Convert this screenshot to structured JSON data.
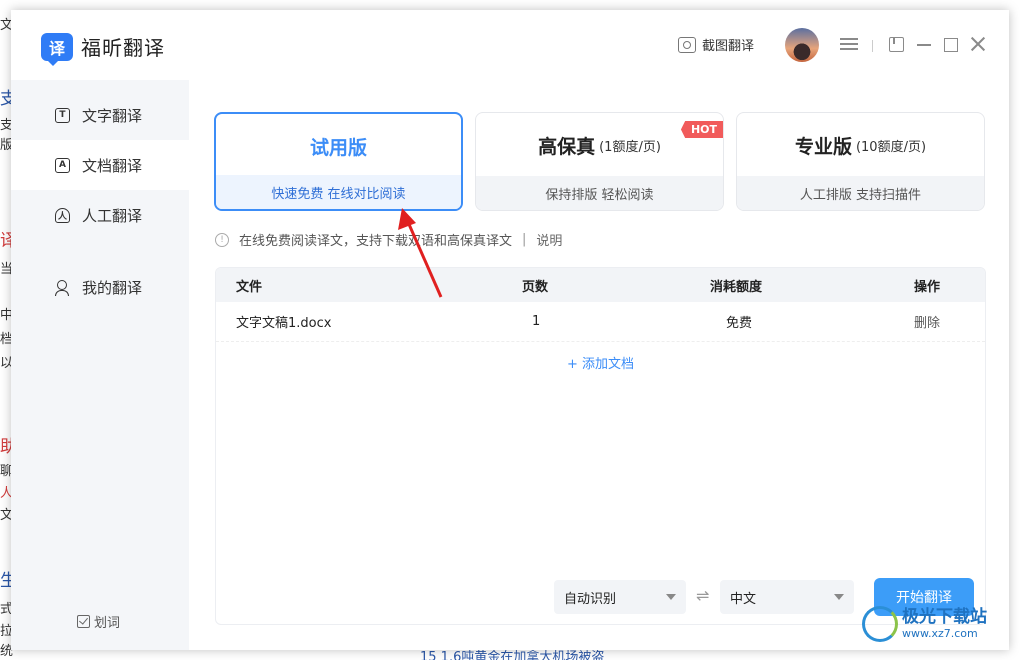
{
  "background": {
    "fragments": [
      "文",
      "支",
      "版",
      "译",
      "当",
      "中",
      "档",
      "以",
      "助",
      "聊",
      "人",
      "文",
      "生",
      "式",
      "拉",
      "统"
    ],
    "bottom_text": "15  1.6吨黄金在加拿大机场被盗"
  },
  "app": {
    "name": "福昕翻译",
    "logo_glyph": "译",
    "screenshot_translate": "截图翻译"
  },
  "sidebar": {
    "items": [
      {
        "label": "文字翻译",
        "icon": "T"
      },
      {
        "label": "文档翻译",
        "icon": "A"
      },
      {
        "label": "人工翻译",
        "icon": "人"
      },
      {
        "label": "我的翻译",
        "icon": "user-icon"
      }
    ],
    "word_pick": "划词"
  },
  "plans": [
    {
      "name": "试用版",
      "sub": "",
      "desc": "快速免费 在线对比阅读",
      "selected": true
    },
    {
      "name": "高保真",
      "sub": "(1额度/页)",
      "desc": "保持排版 轻松阅读",
      "badge": "HOT"
    },
    {
      "name": "专业版",
      "sub": "(10额度/页)",
      "desc": "人工排版 支持扫描件"
    }
  ],
  "notice": {
    "text": "在线免费阅读译文，支持下载双语和高保真译文",
    "sep": "|",
    "link": "说明"
  },
  "table": {
    "headers": {
      "file": "文件",
      "pages": "页数",
      "cost": "消耗额度",
      "action": "操作"
    },
    "rows": [
      {
        "file": "文字文稿1.docx",
        "pages": "1",
        "cost": "免费",
        "action": "删除"
      }
    ],
    "add_doc": "+ 添加文档"
  },
  "controls": {
    "source_lang": "自动识别",
    "swap": "⇌",
    "target_lang": "中文",
    "start": "开始翻译"
  },
  "watermark": {
    "name": "极光下载站",
    "url": "www.xz7.com"
  },
  "colors": {
    "accent": "#3c8df7",
    "hot": "#f15b5b",
    "arrow": "#e02020"
  }
}
